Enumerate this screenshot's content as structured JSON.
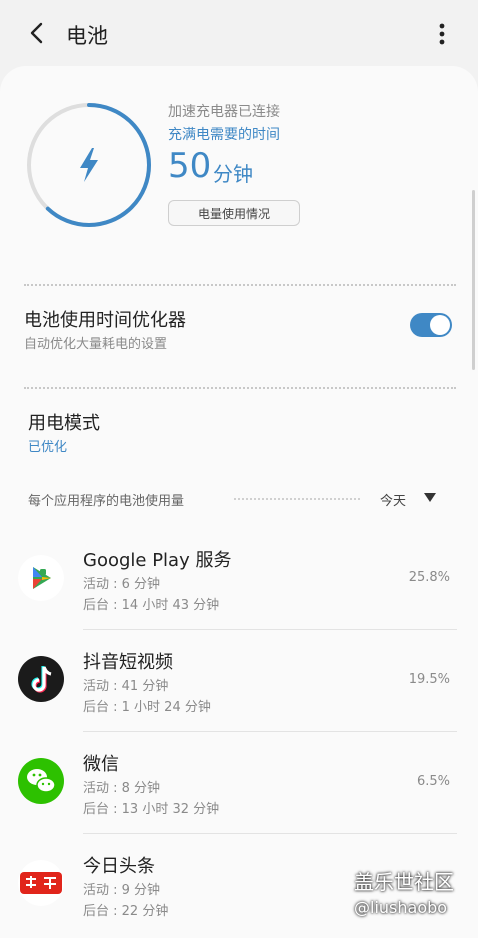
{
  "header": {
    "title": "电池"
  },
  "battery": {
    "status": "加速充电器已连接",
    "time_label": "充满电需要的时间",
    "minutes": "50",
    "unit": "分钟",
    "usage_button": "电量使用情况",
    "charge_level": 0.62
  },
  "optimizer": {
    "title": "电池使用时间优化器",
    "subtitle": "自动优化大量耗电的设置",
    "enabled": true
  },
  "power_mode": {
    "title": "用电模式",
    "value": "已优化"
  },
  "usage_section": {
    "title": "每个应用程序的电池使用量",
    "period": "今天"
  },
  "apps": [
    {
      "name": "Google Play 服务",
      "active": "活动 : 6 分钟",
      "background": "后台 : 14 小时 43 分钟",
      "percent": "25.8%",
      "icon": "google-play-services-icon"
    },
    {
      "name": "抖音短视频",
      "active": "活动 : 41 分钟",
      "background": "后台 : 1 小时 24 分钟",
      "percent": "19.5%",
      "icon": "douyin-icon"
    },
    {
      "name": "微信",
      "active": "活动 : 8 分钟",
      "background": "后台 : 13 小时 32 分钟",
      "percent": "6.5%",
      "icon": "wechat-icon"
    },
    {
      "name": "今日头条",
      "active": "活动 : 9 分钟",
      "background": "后台 : 22 分钟",
      "percent": "",
      "icon": "toutiao-icon"
    }
  ],
  "watermark": {
    "site": "盖乐世社区",
    "user": "@liushaobo"
  },
  "colors": {
    "accent": "#3f88c5",
    "background": "#f2f2f2",
    "card": "#fafafa"
  }
}
